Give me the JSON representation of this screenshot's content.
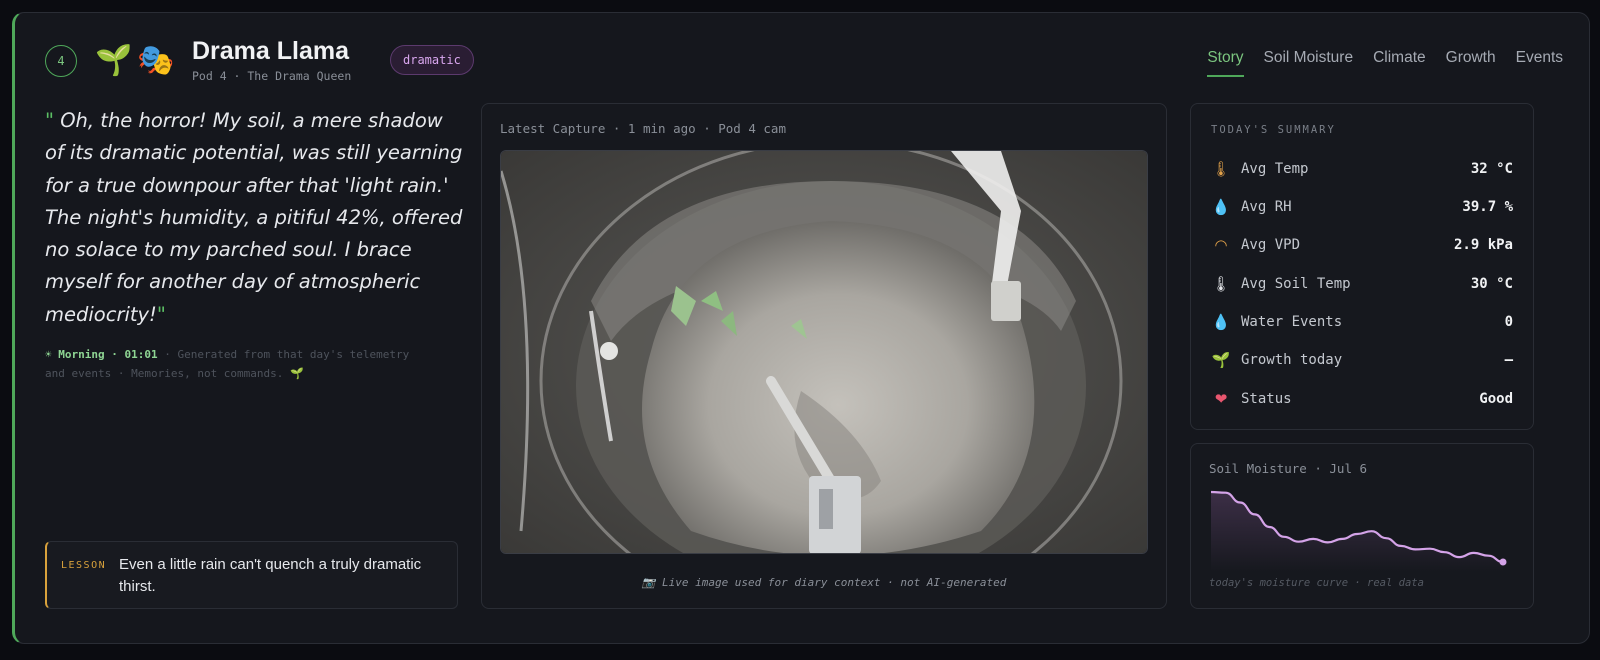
{
  "header": {
    "pod_number": "4",
    "emoji_plant": "🌱",
    "emoji_mask": "🎭",
    "title": "Drama Llama",
    "subtitle": "Pod 4 · The Drama Queen",
    "badge": "dramatic"
  },
  "tabs": [
    {
      "label": "Story",
      "active": true
    },
    {
      "label": "Soil Moisture",
      "active": false
    },
    {
      "label": "Climate",
      "active": false
    },
    {
      "label": "Growth",
      "active": false
    },
    {
      "label": "Events",
      "active": false
    }
  ],
  "diary": {
    "open_quote": "\"",
    "close_quote": "\"",
    "text": "Oh, the horror! My soil, a mere shadow of its dramatic potential, was still yearning for a true downpour after that 'light rain.' The night's humidity, a pitiful 42%, offered no solace to my parched soul. I brace myself for another day of atmospheric mediocrity!",
    "time_icon": "☀",
    "time_of_day": "Morning · 01:01",
    "note": "· Generated from that day's telemetry and events · Memories, not commands.",
    "note_emoji": "🌱"
  },
  "lesson": {
    "label": "LESSON",
    "text": "Even a little rain can't quench a truly dramatic thirst."
  },
  "capture": {
    "header": "Latest Capture · 1 min ago · Pod 4 cam",
    "note": "📷 Live image used for diary context · not AI-generated"
  },
  "summary": {
    "heading": "TODAY'S SUMMARY",
    "rows": [
      {
        "icon": "thermometer-icon",
        "glyph": "🌡",
        "label": "Avg Temp",
        "value": "32 °C"
      },
      {
        "icon": "droplet-icon",
        "glyph": "💧",
        "label": "Avg RH",
        "value": "39.7 %"
      },
      {
        "icon": "gauge-icon",
        "glyph": "◠",
        "label": "Avg VPD",
        "value": "2.9 kPa"
      },
      {
        "icon": "thermometer-icon",
        "glyph": "🌡",
        "label": "Avg Soil Temp",
        "value": "30 °C"
      },
      {
        "icon": "water-drops-icon",
        "glyph": "💧",
        "label": "Water Events",
        "value": "0"
      },
      {
        "icon": "sprout-icon",
        "glyph": "🌱",
        "label": "Growth today",
        "value": "—"
      },
      {
        "icon": "heart-icon",
        "glyph": "❤",
        "label": "Status",
        "value": "Good"
      }
    ]
  },
  "soil": {
    "header": "Soil Moisture · Jul 6",
    "footer": "today's moisture curve · real data",
    "line_color": "#d4a3e8",
    "chart_data": {
      "type": "area",
      "title": "Soil Moisture · Jul 6",
      "x": [
        0,
        1,
        2,
        3,
        4,
        5,
        6,
        7,
        8,
        9,
        10,
        11,
        12,
        13,
        14,
        15,
        16,
        17,
        18,
        19,
        20
      ],
      "values": [
        100,
        99,
        85,
        68,
        50,
        36,
        29,
        33,
        28,
        33,
        40,
        44,
        34,
        23,
        18,
        19,
        14,
        7,
        13,
        9,
        0
      ],
      "xlabel": "",
      "ylabel": ""
    }
  }
}
